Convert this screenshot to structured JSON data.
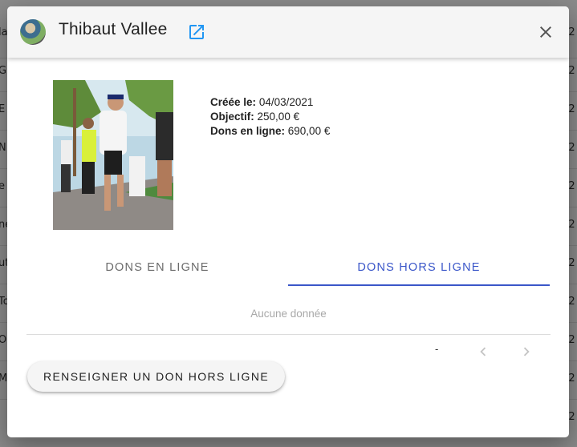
{
  "background": {
    "left_fragments": [
      "la",
      "G",
      "E",
      "N",
      "e",
      "ne",
      "ut",
      "To",
      "O",
      "M"
    ],
    "right_fragments": [
      "/2",
      "/2",
      "/2",
      "/2",
      "/2",
      "/2",
      "/2",
      "/2",
      "/2",
      "/2",
      "/2"
    ]
  },
  "dialog": {
    "title": "Thibaut Vallee",
    "avatar_icon": "user-avatar",
    "external_link_icon": "open-in-new-icon",
    "close_icon": "close-icon"
  },
  "info": {
    "created_label": "Créée le:",
    "created_value": "04/03/2021",
    "goal_label": "Objectif:",
    "goal_value": "250,00 €",
    "online_label": "Dons en ligne:",
    "online_value": "690,00 €"
  },
  "tabs": [
    {
      "label": "DONS EN LIGNE",
      "active": false
    },
    {
      "label": "DONS HORS LIGNE",
      "active": true
    }
  ],
  "table": {
    "empty_text": "Aucune donnée"
  },
  "pagination": {
    "range_text": "-",
    "prev_icon": "chevron-left-icon",
    "next_icon": "chevron-right-icon"
  },
  "actions": {
    "add_offline_donation_label": "RENSEIGNER UN DON HORS LIGNE"
  },
  "colors": {
    "accent": "#3b57c9",
    "link_icon": "#2196f3",
    "header_bg": "#f5f5f5"
  }
}
